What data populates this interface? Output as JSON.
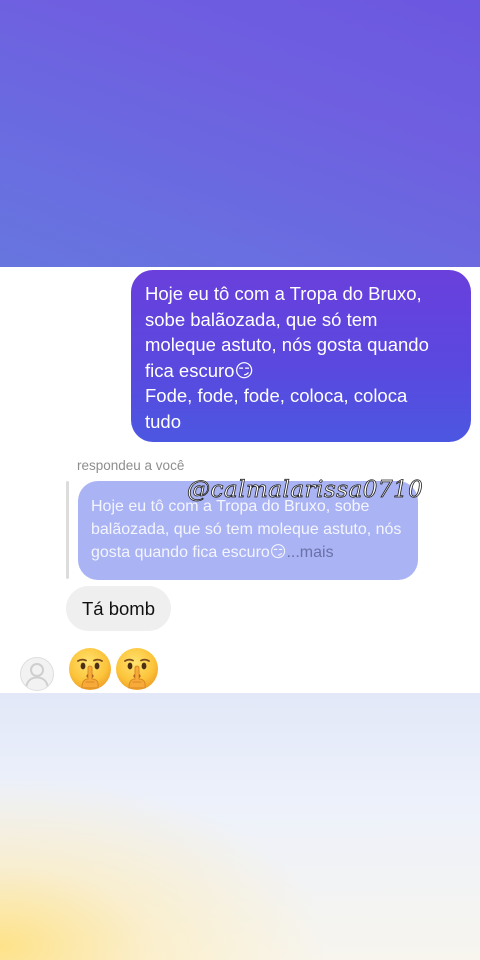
{
  "sent_message": {
    "text": "Hoje eu tô com a Tropa do Bruxo,\nsobe balãozada, que só tem\nmoleque astuto, nós gosta quando\nfica escuro😏\nFode, fode, fode, coloca, coloca\ntudo"
  },
  "reply": {
    "label": "respondeu a você",
    "quoted_text": "Hoje eu tô com a Tropa do Bruxo, sobe balãozada, que só tem moleque astuto, nós gosta quando fica escuro😏",
    "more_label": "...mais",
    "watermark": "@calmalarissa0710"
  },
  "received_message": {
    "text": "Tá bomb"
  },
  "reactions": {
    "emoji_icon": "shushing-face-icon",
    "count": 2
  },
  "colors": {
    "sent_bubble": "#5a48df",
    "quoted_bubble": "#aab4f4",
    "received_bubble": "#efefef"
  }
}
